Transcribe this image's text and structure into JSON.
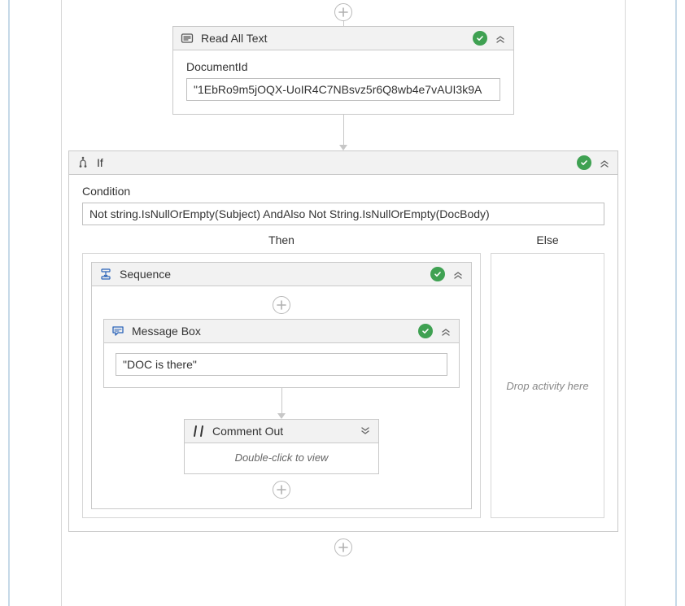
{
  "readAllText": {
    "title": "Read All Text",
    "fieldLabel": "DocumentId",
    "value": "\"1EbRo9m5jOQX-UoIR4C7NBsvz5r6Q8wb4e7vAUI3k9A"
  },
  "ifActivity": {
    "title": "If",
    "conditionLabel": "Condition",
    "conditionValue": "Not string.IsNullOrEmpty(Subject) AndAlso Not String.IsNullOrEmpty(DocBody)",
    "thenLabel": "Then",
    "elseLabel": "Else",
    "elseHint": "Drop activity here"
  },
  "sequence": {
    "title": "Sequence"
  },
  "messageBox": {
    "title": "Message Box",
    "value": "\"DOC is there\""
  },
  "commentOut": {
    "title": "Comment Out",
    "hint": "Double-click to view"
  }
}
